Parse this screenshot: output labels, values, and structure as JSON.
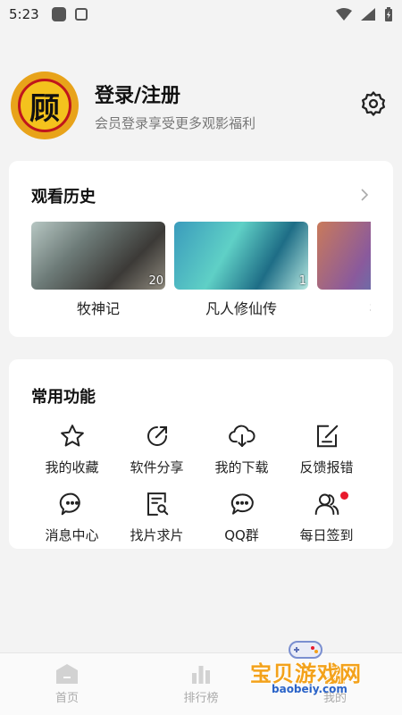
{
  "status": {
    "time": "5:23"
  },
  "profile": {
    "avatar_char": "顾",
    "title": "登录/注册",
    "subtitle": "会员登录享受更多观影福利"
  },
  "history": {
    "title": "观看历史",
    "items": [
      {
        "label": "牧神记",
        "badge": "20"
      },
      {
        "label": "凡人修仙传",
        "badge": "1"
      },
      {
        "label": "疯狂",
        "badge": ""
      }
    ]
  },
  "functions": {
    "title": "常用功能",
    "items": [
      {
        "label": "我的收藏",
        "icon": "star-icon"
      },
      {
        "label": "软件分享",
        "icon": "share-icon"
      },
      {
        "label": "我的下载",
        "icon": "cloud-download-icon"
      },
      {
        "label": "反馈报错",
        "icon": "feedback-edit-icon"
      },
      {
        "label": "消息中心",
        "icon": "message-icon"
      },
      {
        "label": "找片求片",
        "icon": "search-document-icon"
      },
      {
        "label": "QQ群",
        "icon": "chat-icon"
      },
      {
        "label": "每日签到",
        "icon": "users-icon"
      }
    ]
  },
  "nav": {
    "items": [
      {
        "label": "首页",
        "icon": "home-icon"
      },
      {
        "label": "排行榜",
        "icon": "bar-chart-icon"
      },
      {
        "label": "我的",
        "icon": "profile-icon"
      }
    ]
  },
  "watermark": {
    "title": "宝贝游戏网",
    "url": "baobeiy.com"
  },
  "colors": {
    "accent_red": "#e8192c",
    "background": "#f3f3f3"
  }
}
